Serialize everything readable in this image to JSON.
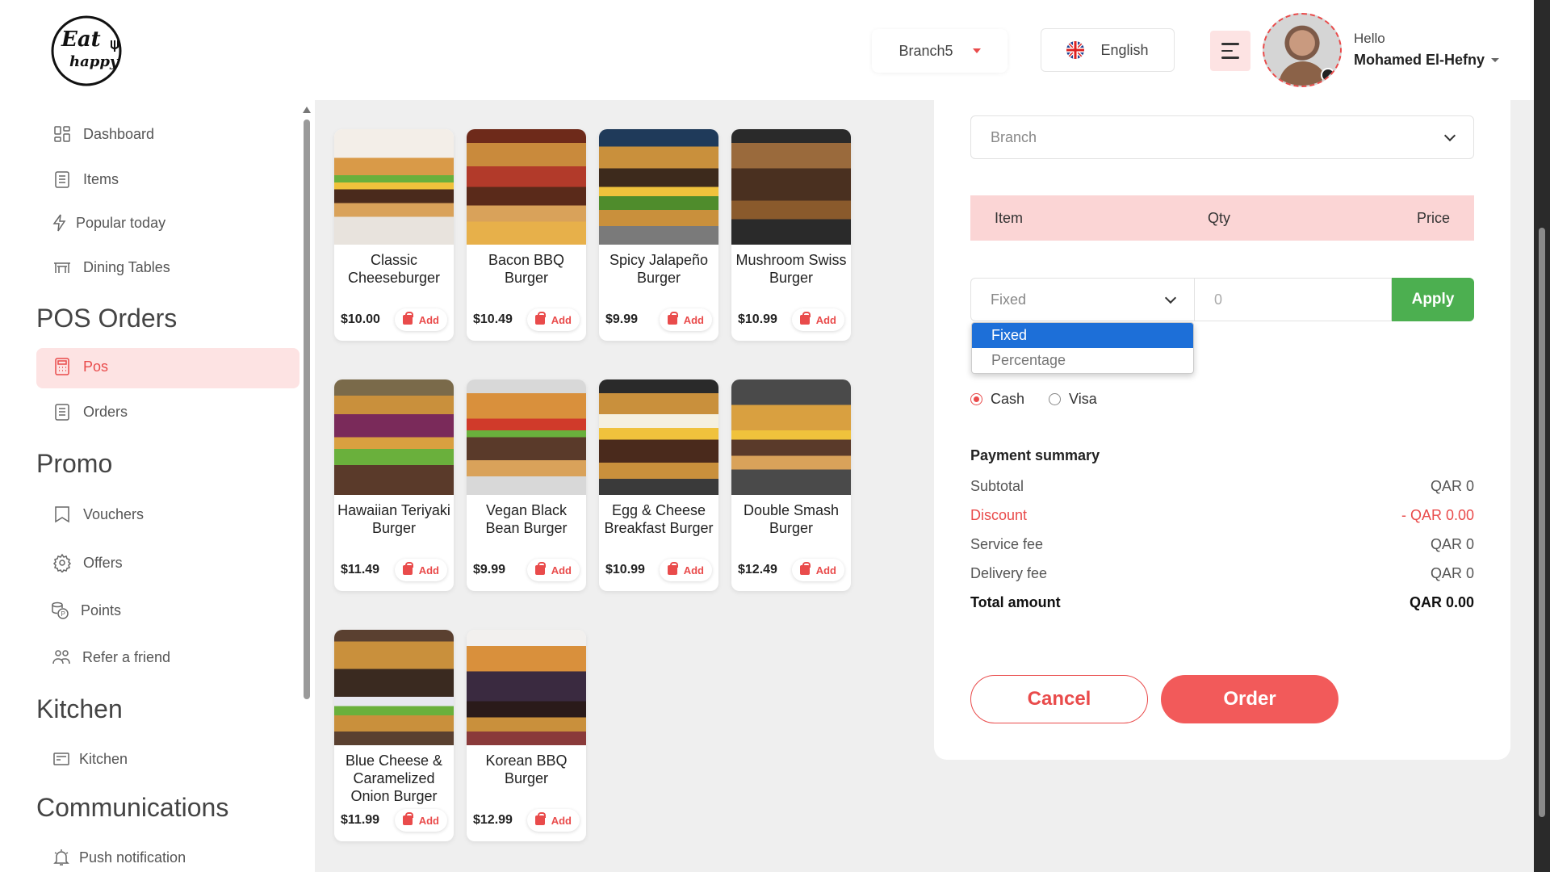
{
  "header": {
    "logo_text_1": "Eat",
    "logo_text_2": "happy",
    "branch": "Branch5",
    "language": "English",
    "greeting": "Hello",
    "user_name": "Mohamed El-Hefny"
  },
  "sidebar": {
    "items_top": [
      {
        "label": "Dashboard",
        "icon": "dashboard-icon"
      },
      {
        "label": "Items",
        "icon": "list-icon"
      },
      {
        "label": "Popular today",
        "icon": "lightning-icon"
      },
      {
        "label": "Dining Tables",
        "icon": "table-icon"
      }
    ],
    "sections": {
      "pos_orders": "POS Orders",
      "promo": "Promo",
      "kitchen": "Kitchen",
      "communications": "Communications"
    },
    "pos_items": [
      {
        "label": "Pos",
        "icon": "calculator-icon",
        "active": true
      },
      {
        "label": "Orders",
        "icon": "list-icon"
      }
    ],
    "promo_items": [
      {
        "label": "Vouchers",
        "icon": "voucher-icon"
      },
      {
        "label": "Offers",
        "icon": "gear-badge-icon"
      },
      {
        "label": "Points",
        "icon": "coins-icon"
      },
      {
        "label": "Refer a friend",
        "icon": "people-icon"
      }
    ],
    "kitchen_items": [
      {
        "label": "Kitchen",
        "icon": "kitchen-icon"
      }
    ],
    "comm_items": [
      {
        "label": "Push notification",
        "icon": "bell-icon"
      }
    ]
  },
  "products": [
    {
      "name": "Classic Cheeseburger",
      "price": "$10.00",
      "add": "Add"
    },
    {
      "name": "Bacon BBQ Burger",
      "price": "$10.49",
      "add": "Add"
    },
    {
      "name": "Spicy Jalapeño Burger",
      "price": "$9.99",
      "add": "Add"
    },
    {
      "name": "Mushroom Swiss Burger",
      "price": "$10.99",
      "add": "Add"
    },
    {
      "name": "Hawaiian Teriyaki Burger",
      "price": "$11.49",
      "add": "Add"
    },
    {
      "name": "Vegan Black Bean Burger",
      "price": "$9.99",
      "add": "Add"
    },
    {
      "name": "Egg & Cheese Breakfast Burger",
      "price": "$10.99",
      "add": "Add"
    },
    {
      "name": "Double Smash Burger",
      "price": "$12.49",
      "add": "Add"
    },
    {
      "name": "Blue Cheese & Caramelized Onion Burger",
      "price": "$11.99",
      "add": "Add"
    },
    {
      "name": "Korean BBQ Burger",
      "price": "$12.99",
      "add": "Add"
    }
  ],
  "order_panel": {
    "branch_placeholder": "Branch",
    "table_headers": {
      "item": "Item",
      "qty": "Qty",
      "price": "Price"
    },
    "discount_type": "Fixed",
    "discount_value": "0",
    "apply_label": "Apply",
    "discount_options": [
      "Fixed",
      "Percentage"
    ],
    "payment_methods": [
      {
        "label": "Cash",
        "selected": true
      },
      {
        "label": "Visa",
        "selected": false
      }
    ],
    "summary_title": "Payment summary",
    "summary": {
      "subtotal_label": "Subtotal",
      "subtotal_value": "QAR 0",
      "discount_label": "Discount",
      "discount_value": "- QAR 0.00",
      "service_label": "Service fee",
      "service_value": "QAR 0",
      "delivery_label": "Delivery fee",
      "delivery_value": "QAR 0",
      "total_label": "Total amount",
      "total_value": "QAR 0.00"
    },
    "cancel_label": "Cancel",
    "order_label": "Order"
  },
  "colors": {
    "accent": "#e94b4b",
    "active_bg": "#fde3e3",
    "apply_green": "#4caf50",
    "dropdown_selected": "#1d6fd8"
  }
}
